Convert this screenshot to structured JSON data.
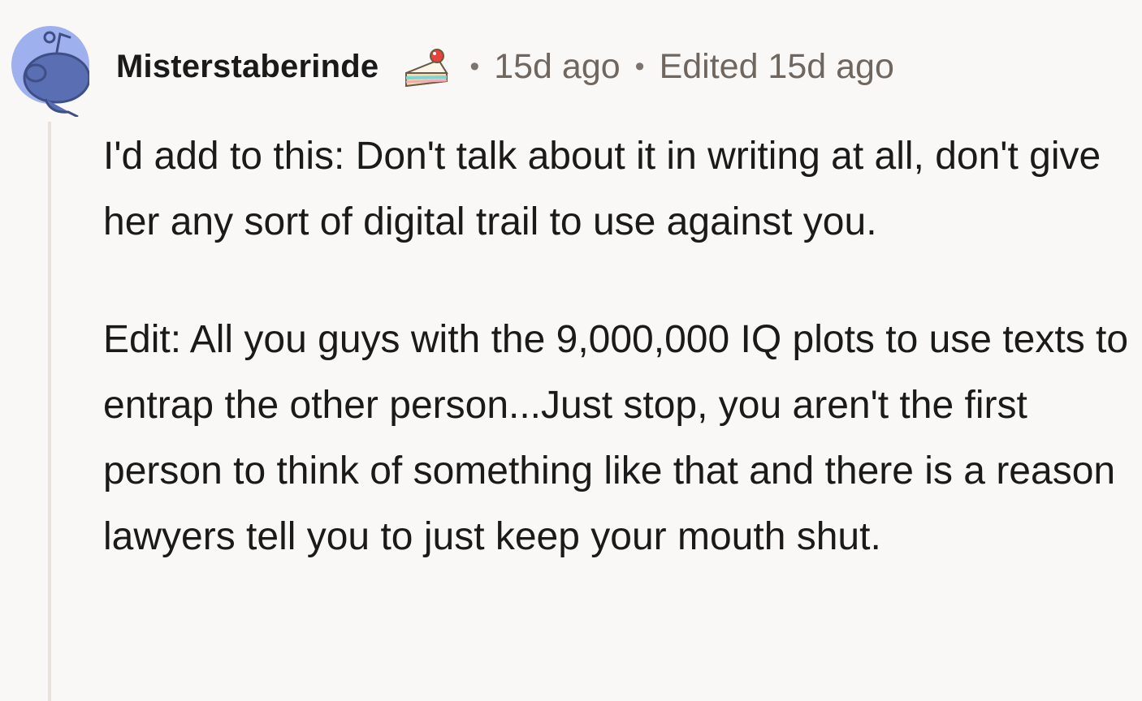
{
  "comment": {
    "author": "Misterstaberinde",
    "time_posted": "15d ago",
    "edited": "Edited 15d ago",
    "separator": "•",
    "paragraphs": [
      "I'd add to this: Don't talk about it in writing at all, don't give her any sort of digital trail to use against you.",
      "Edit: All you guys with the 9,000,000 IQ plots to use texts to entrap the other person...Just stop, you aren't the first person to think of something like that and there is a reason lawyers tell you to just keep your mouth shut."
    ]
  },
  "icons": {
    "avatar": "snoo-avatar",
    "badge": "cake-day-icon"
  },
  "colors": {
    "background": "#f9f8f6",
    "avatar": "#9fb0ef",
    "text": "#1a1a1b",
    "meta": "#6f6660",
    "thread_line": "#e8e2dd"
  }
}
